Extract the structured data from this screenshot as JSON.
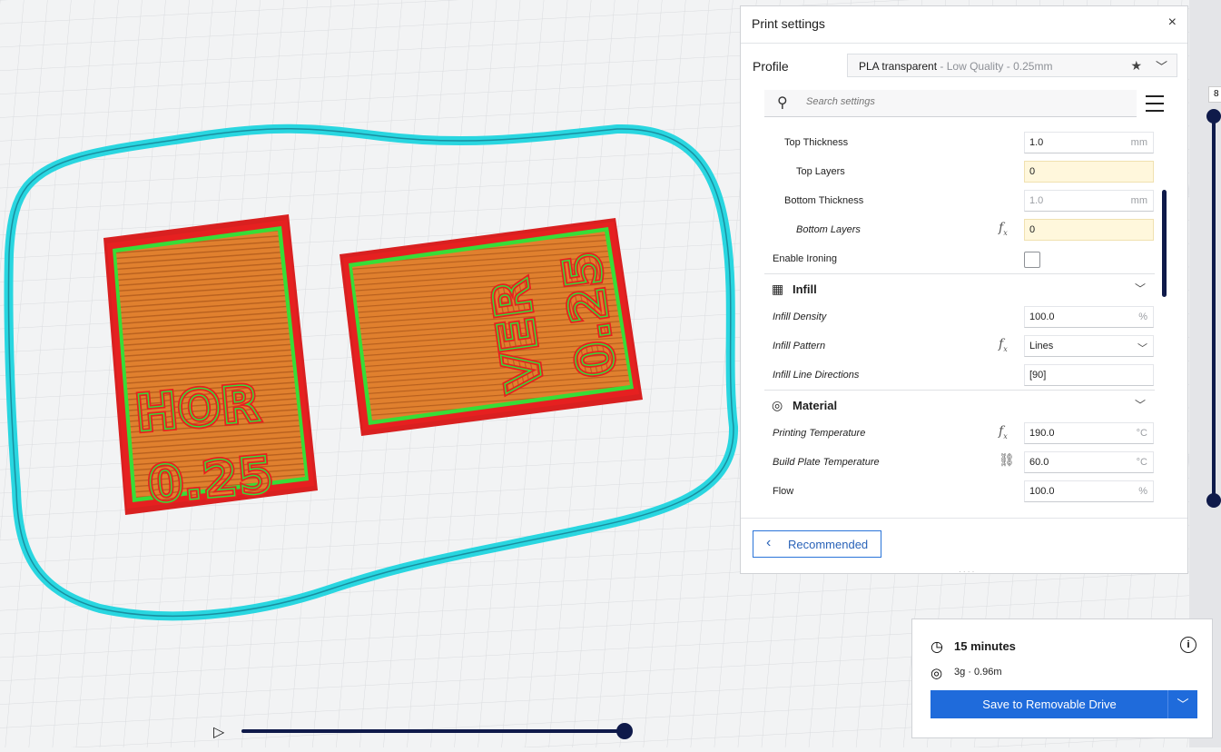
{
  "panel": {
    "title": "Print settings",
    "close": "×",
    "profile_label": "Profile",
    "profile_name": "PLA transparent",
    "profile_detail": " - Low Quality - 0.25mm",
    "search_placeholder": "Search settings",
    "recommended_label": "Recommended"
  },
  "settings": {
    "top_thickness": {
      "label": "Top Thickness",
      "value": "1.0",
      "unit": "mm"
    },
    "top_layers": {
      "label": "Top Layers",
      "value": "0"
    },
    "bottom_thickness": {
      "label": "Bottom Thickness",
      "value": "1.0",
      "unit": "mm"
    },
    "bottom_layers": {
      "label": "Bottom Layers",
      "value": "0"
    },
    "enable_ironing": {
      "label": "Enable Ironing"
    },
    "infill_category": "Infill",
    "infill_density": {
      "label": "Infill Density",
      "value": "100.0",
      "unit": "%"
    },
    "infill_pattern": {
      "label": "Infill Pattern",
      "value": "Lines"
    },
    "infill_line_directions": {
      "label": "Infill Line Directions",
      "value": "[90]"
    },
    "material_category": "Material",
    "printing_temperature": {
      "label": "Printing Temperature",
      "value": "190.0",
      "unit": "°C"
    },
    "build_plate_temperature": {
      "label": "Build Plate Temperature",
      "value": "60.0",
      "unit": "°C"
    },
    "flow": {
      "label": "Flow",
      "value": "100.0",
      "unit": "%"
    }
  },
  "estimate": {
    "time": "15 minutes",
    "material": "3g · 0.96m",
    "save_label": "Save to Removable Drive"
  },
  "model_text": {
    "hor": "HOR",
    "hor_val": "0.25",
    "ver": "VER",
    "ver_val": "0.25"
  },
  "layer_number": "8",
  "colors": {
    "skirt": "#29d6e0",
    "wall": "#e62020",
    "infill": "#e0802e",
    "inner_wall": "#37dd37",
    "accent": "#1f6bdb"
  }
}
